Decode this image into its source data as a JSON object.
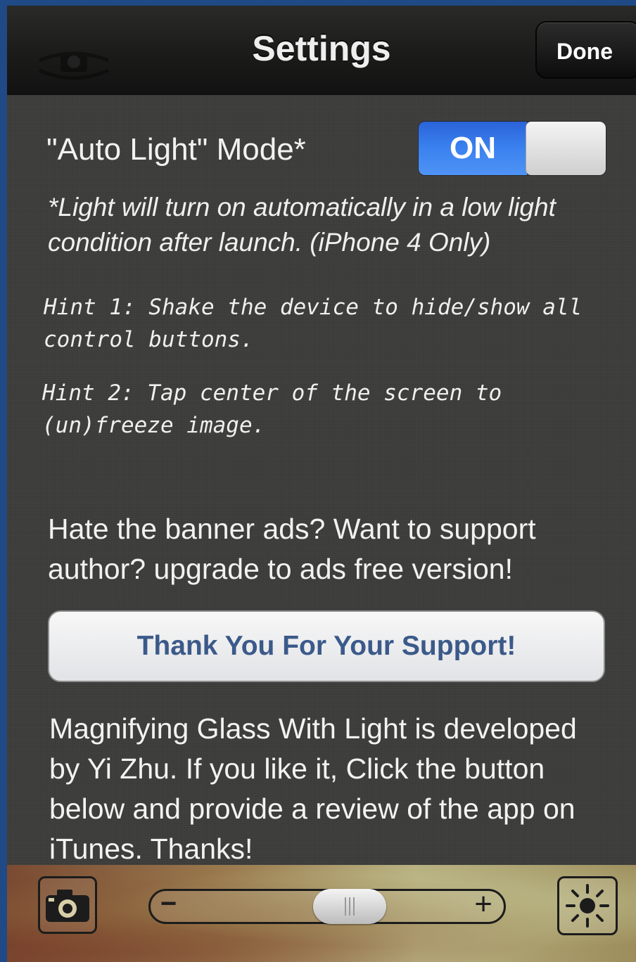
{
  "navbar": {
    "title": "Settings",
    "done_label": "Done"
  },
  "auto_light": {
    "label": "\"Auto Light\" Mode*",
    "toggle_state": "ON",
    "note": "*Light will turn on automatically in a low light condition after launch. (iPhone 4 Only)"
  },
  "hints": {
    "hint1": "Hint 1: Shake the device to hide/show all control buttons.",
    "hint2": "Hint 2: Tap center of the screen to (un)freeze image."
  },
  "upgrade": {
    "text": "Hate the banner ads? Want to support author? upgrade to ads free version!",
    "button_label": "Thank You For Your Support!"
  },
  "about": {
    "text": "Magnifying Glass With Light is developed by Yi Zhu.  If you like it, Click the button below and provide a review of the app on iTunes. Thanks!"
  },
  "toolbar": {
    "camera_icon": "camera-icon",
    "zoom_minus": "−",
    "zoom_plus": "+",
    "zoom_level": 0.58,
    "light_icon": "sun-icon"
  },
  "colors": {
    "toggle_on": "#3b82f0",
    "support_button_text": "#3b5a8a",
    "background": "#3d3e3b"
  }
}
